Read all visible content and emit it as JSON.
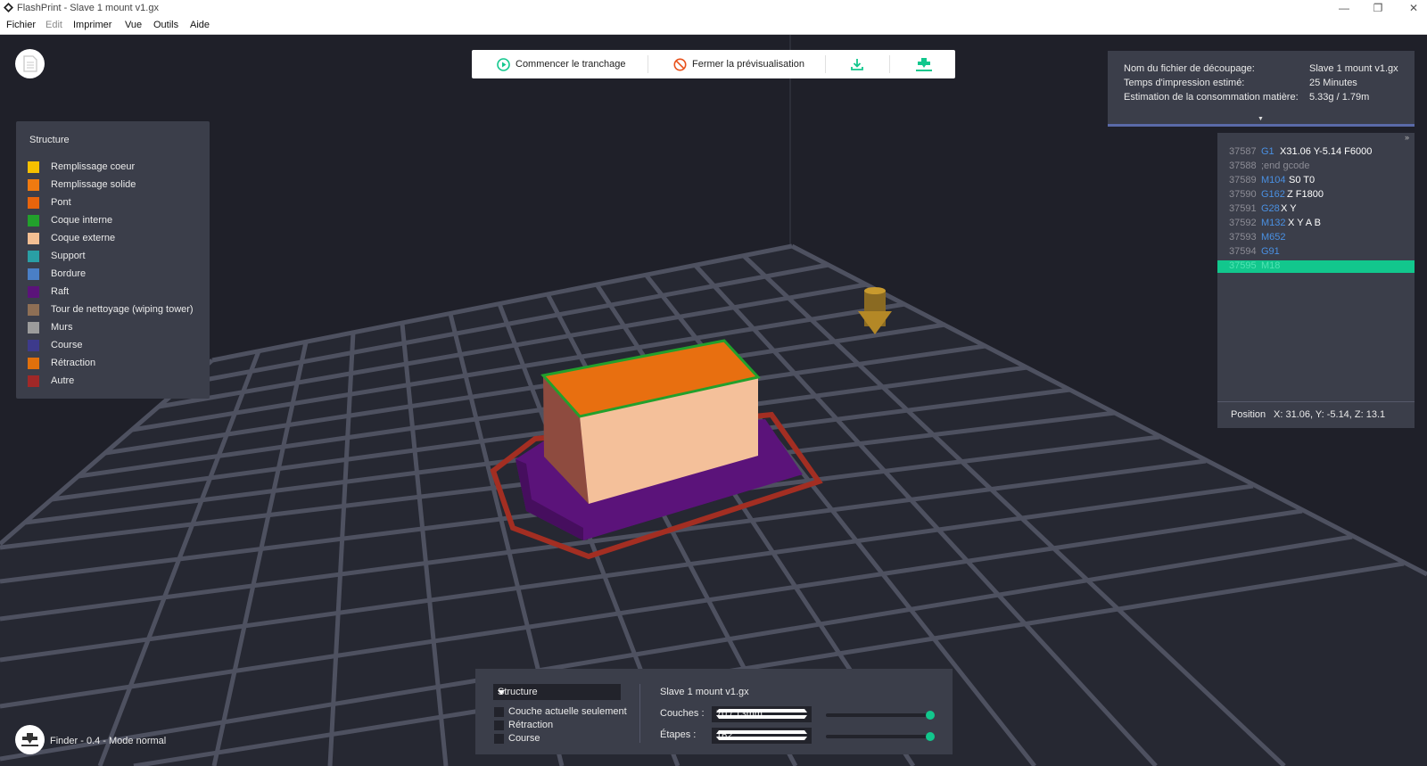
{
  "window": {
    "title": "FlashPrint - Slave 1 mount v1.gx"
  },
  "menu": [
    {
      "label": "Fichier",
      "disabled": false
    },
    {
      "label": "Edit",
      "disabled": true
    },
    {
      "label": "Imprimer",
      "disabled": false
    },
    {
      "label": "Vue",
      "disabled": false
    },
    {
      "label": "Outils",
      "disabled": false
    },
    {
      "label": "Aide",
      "disabled": false
    }
  ],
  "toolbar": {
    "start_label": "Commencer le tranchage",
    "close_label": "Fermer la prévisualisation",
    "export_icon": "download-icon",
    "print_icon": "print-nozzle-icon"
  },
  "legend": {
    "header": "Structure",
    "items": [
      {
        "label": "Remplissage coeur",
        "color": "#f6c000"
      },
      {
        "label": "Remplissage solide",
        "color": "#f07a10"
      },
      {
        "label": "Pont",
        "color": "#e8640c"
      },
      {
        "label": "Coque interne",
        "color": "#22a02c"
      },
      {
        "label": "Coque externe",
        "color": "#f4bf93"
      },
      {
        "label": "Support",
        "color": "#2a9fa5"
      },
      {
        "label": "Bordure",
        "color": "#4a7fc6"
      },
      {
        "label": "Raft",
        "color": "#5b137a"
      },
      {
        "label": "Tour de nettoyage (wiping tower)",
        "color": "#8e6f55"
      },
      {
        "label": "Murs",
        "color": "#9c9c9c"
      },
      {
        "label": "Course",
        "color": "#3d3a8c"
      },
      {
        "label": "Rétraction",
        "color": "#e0700c"
      },
      {
        "label": "Autre",
        "color": "#a02828"
      }
    ]
  },
  "info": {
    "rows": [
      {
        "key": "Nom du fichier de découpage:",
        "value": "Slave 1 mount v1.gx"
      },
      {
        "key": "Temps d'impression estimé:",
        "value": "25 Minutes"
      },
      {
        "key": "Estimation de la consommation matière:",
        "value": "5.33g / 1.79m"
      }
    ]
  },
  "gcode": {
    "expand_glyph": "»",
    "lines": [
      {
        "num": "37587",
        "cmd": "G1",
        "args": "X31.06 Y-5.14 F6000",
        "style": "code"
      },
      {
        "num": "37588",
        "cmd": ";end gcode",
        "args": "",
        "style": "comment"
      },
      {
        "num": "37589",
        "cmd": "M104",
        "args": "S0 T0",
        "style": "code"
      },
      {
        "num": "37590",
        "cmd": "G162",
        "args": "Z F1800",
        "style": "code"
      },
      {
        "num": "37591",
        "cmd": "G28",
        "args": "X Y",
        "style": "code"
      },
      {
        "num": "37592",
        "cmd": "M132",
        "args": "X Y A B",
        "style": "code"
      },
      {
        "num": "37593",
        "cmd": "M652",
        "args": "",
        "style": "code"
      },
      {
        "num": "37594",
        "cmd": "G91",
        "args": "",
        "style": "code"
      },
      {
        "num": "37595",
        "cmd": "M18",
        "args": "",
        "style": "active"
      }
    ],
    "position_label": "Position",
    "position_value": "X: 31.06, Y: -5.14, Z: 13.1"
  },
  "bottom": {
    "view_select": "Structure",
    "checkboxes": [
      {
        "label": "Couche actuelle seulement",
        "checked": false
      },
      {
        "label": "Rétraction",
        "checked": false
      },
      {
        "label": "Course",
        "checked": false
      }
    ],
    "filename": "Slave 1 mount v1.gx",
    "layers_label": "Couches :",
    "layers_value": "70 / 13mm",
    "steps_label": "Étapes :",
    "steps_value": "162",
    "layers_slider_fraction": 1.0,
    "steps_slider_fraction": 1.0
  },
  "status": {
    "text": "Finder - 0.4 - Mode normal"
  },
  "colors": {
    "accent": "#12c78d",
    "panel": "#3b3e4a",
    "background": "#1f2029"
  }
}
